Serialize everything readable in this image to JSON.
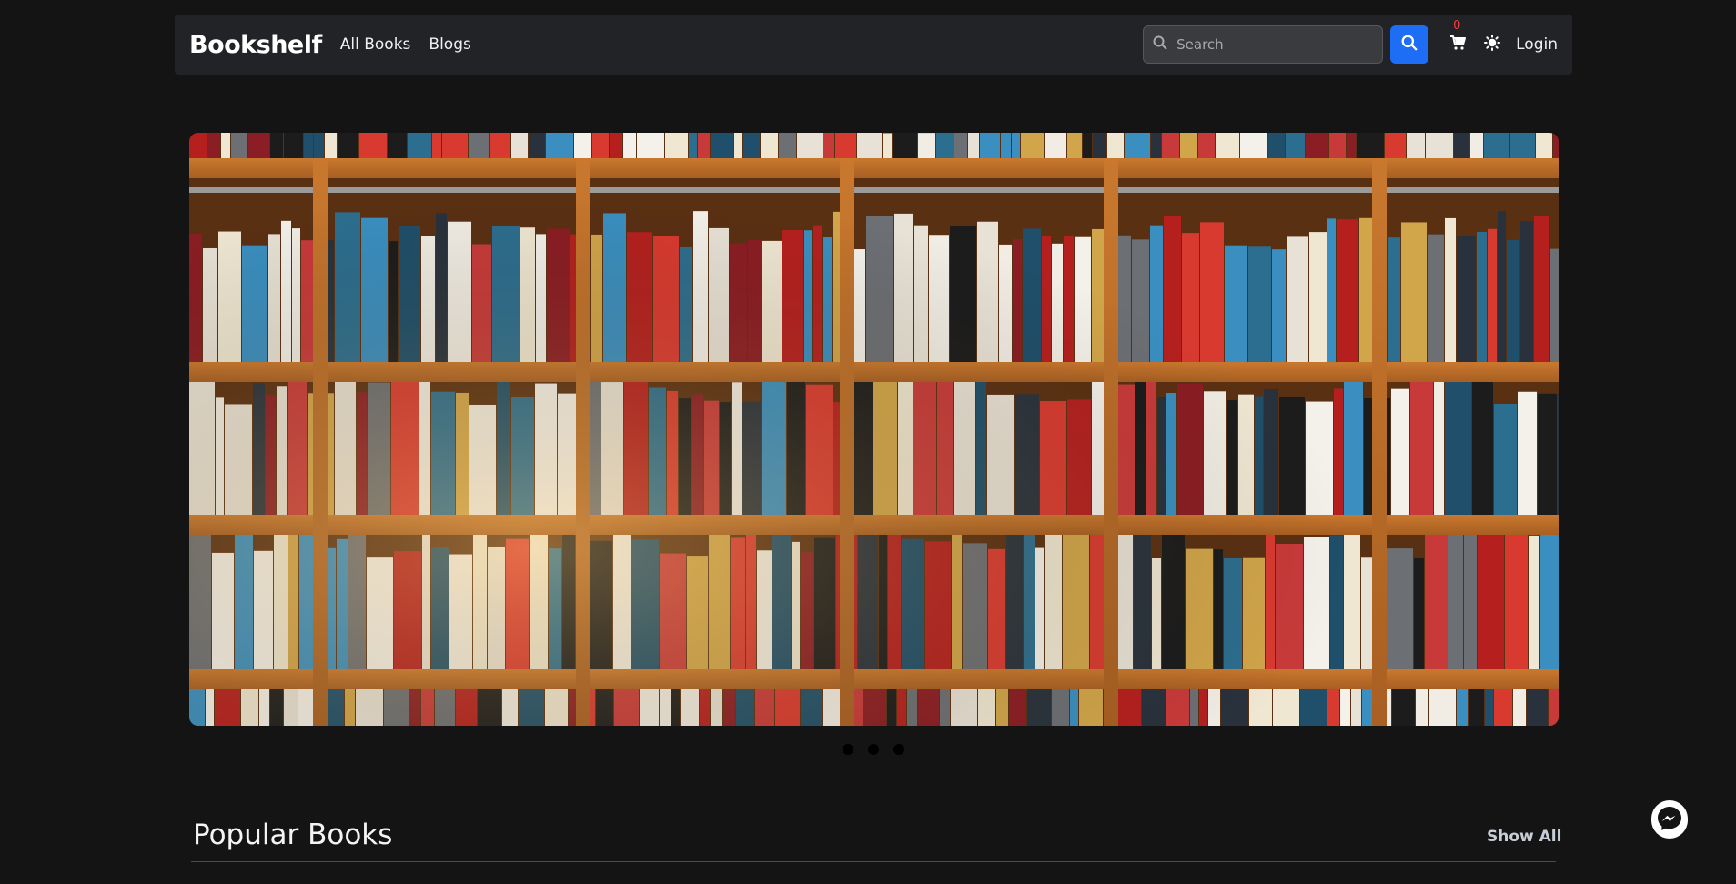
{
  "nav": {
    "brand": "Bookshelf",
    "links": [
      "All Books",
      "Blogs"
    ],
    "search_placeholder": "Search",
    "cart_count": "0",
    "login": "Login"
  },
  "hero": {
    "slide_count": 3,
    "active_slide": 1
  },
  "section": {
    "title": "Popular Books",
    "show_all": "Show All"
  },
  "colors": {
    "background": "#141414",
    "navbar": "#222326",
    "accent": "#1d6ef5",
    "cart_badge": "#ff3b3b"
  },
  "icons": {
    "search": "search-icon",
    "cart": "cart-icon",
    "theme": "sun-icon",
    "chat": "messenger-icon"
  }
}
